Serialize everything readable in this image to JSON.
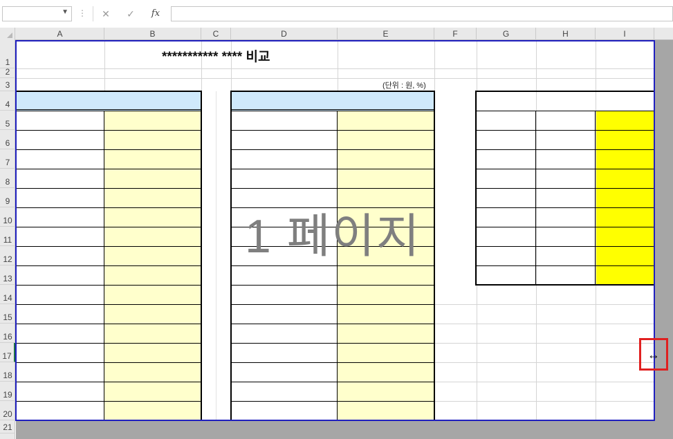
{
  "formula_bar": {
    "name_box_value": "",
    "cancel_icon": "✕",
    "enter_icon": "✓",
    "fx_label": "fx",
    "formula_value": ""
  },
  "columns": [
    "A",
    "B",
    "C",
    "D",
    "E",
    "F",
    "G",
    "H",
    "I"
  ],
  "rows": [
    "1",
    "2",
    "3",
    "4",
    "5",
    "6",
    "7",
    "8",
    "9",
    "10",
    "11",
    "12",
    "13",
    "14",
    "15",
    "16",
    "17",
    "18",
    "19",
    "20",
    "21"
  ],
  "sheet": {
    "title": "*********** **** 비교",
    "unit_note": "(단위 : 원, %)",
    "page_watermark": "1 페이지"
  },
  "colors": {
    "page_break_border": "#1f1fbf",
    "header_fill": "#cfe9fb",
    "light_yellow_fill": "#ffffcc",
    "yellow_fill": "#ffff00",
    "cursor_highlight": "#e02020"
  },
  "cursor": {
    "icon": "resize-horizontal-cursor",
    "glyph": "↔"
  }
}
